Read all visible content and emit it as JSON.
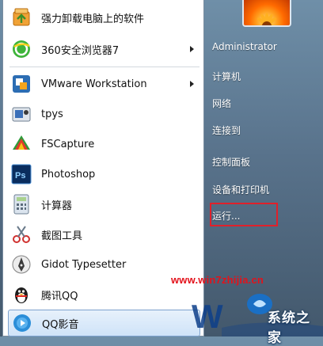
{
  "programs": [
    {
      "label": "强力卸载电脑上的软件",
      "icon": "uninstall-icon",
      "has_submenu": false
    },
    {
      "label": "360安全浏览器7",
      "icon": "360-browser-icon",
      "has_submenu": true
    },
    {
      "label": "VMware Workstation",
      "icon": "vmware-icon",
      "has_submenu": true
    },
    {
      "label": "tpys",
      "icon": "tpys-icon",
      "has_submenu": false
    },
    {
      "label": "FSCapture",
      "icon": "fscapture-icon",
      "has_submenu": false
    },
    {
      "label": "Photoshop",
      "icon": "photoshop-icon",
      "has_submenu": false
    },
    {
      "label": "计算器",
      "icon": "calculator-icon",
      "has_submenu": false
    },
    {
      "label": "截图工具",
      "icon": "snipping-tool-icon",
      "has_submenu": false
    },
    {
      "label": "Gidot Typesetter",
      "icon": "gidot-icon",
      "has_submenu": false
    },
    {
      "label": "腾讯QQ",
      "icon": "qq-penguin-icon",
      "has_submenu": false
    },
    {
      "label": "QQ影音",
      "icon": "qq-player-icon",
      "has_submenu": false
    }
  ],
  "right_pane": {
    "user": "Administrator",
    "computer": "计算机",
    "network": "网络",
    "connect": "连接到",
    "control_panel": "控制面板",
    "devices_printers": "设备和打印机",
    "run": "运行..."
  },
  "watermark": {
    "url": "www.win7zhijia.cn",
    "site_name": "系统之家"
  },
  "colors": {
    "highlight_box": "#e0202a",
    "photoshop_blue": "#0a2d5e"
  }
}
